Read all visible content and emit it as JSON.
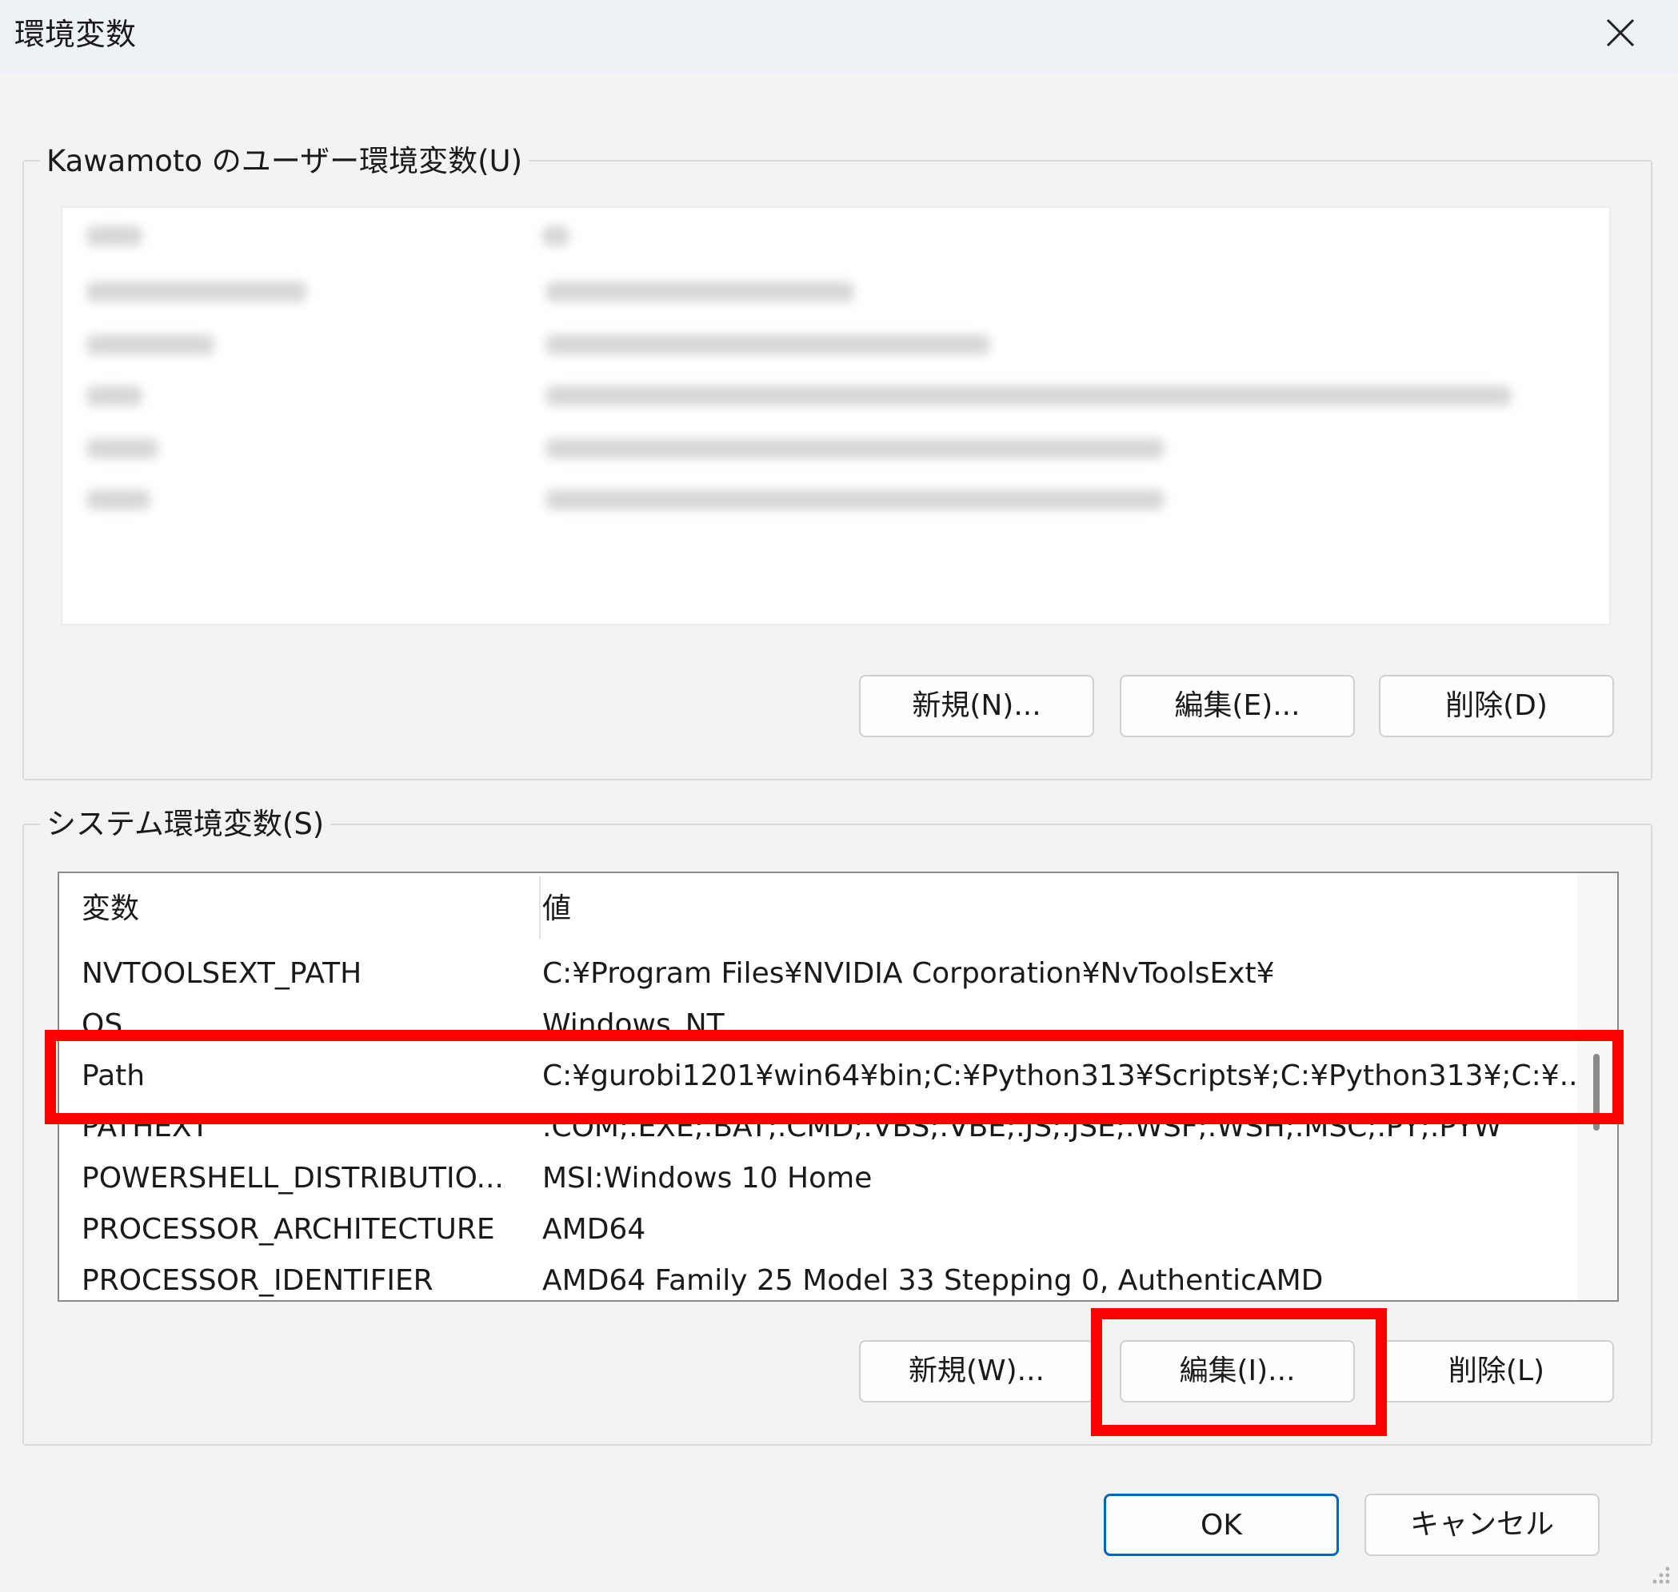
{
  "window": {
    "title": "環境変数",
    "close_icon": "close-icon"
  },
  "user_vars": {
    "legend": "Kawamoto のユーザー環境変数(U)",
    "buttons": {
      "new": "新規(N)...",
      "edit": "編集(E)...",
      "delete": "削除(D)"
    }
  },
  "system_vars": {
    "legend": "システム環境変数(S)",
    "columns": {
      "variable": "変数",
      "value": "値"
    },
    "rows": [
      {
        "variable": "NVTOOLSEXT_PATH",
        "value": "C:¥Program Files¥NVIDIA Corporation¥NvToolsExt¥"
      },
      {
        "variable": "OS",
        "value": "Windows_NT"
      },
      {
        "variable": "Path",
        "value": "C:¥gurobi1201¥win64¥bin;C:¥Python313¥Scripts¥;C:¥Python313¥;C:¥..."
      },
      {
        "variable": "PATHEXT",
        "value": ".COM;.EXE;.BAT;.CMD;.VBS;.VBE;.JS;.JSE;.WSF;.WSH;.MSC;.PY;.PYW"
      },
      {
        "variable": "POWERSHELL_DISTRIBUTIO...",
        "value": "MSI:Windows 10 Home"
      },
      {
        "variable": "PROCESSOR_ARCHITECTURE",
        "value": "AMD64"
      },
      {
        "variable": "PROCESSOR_IDENTIFIER",
        "value": "AMD64 Family 25 Model 33 Stepping 0, AuthenticAMD"
      }
    ],
    "buttons": {
      "new": "新規(W)...",
      "edit": "編集(I)...",
      "delete": "削除(L)"
    }
  },
  "footer": {
    "ok": "OK",
    "cancel": "キャンセル"
  },
  "colors": {
    "highlight": "#ff0000",
    "primary_border": "#0067c0"
  }
}
